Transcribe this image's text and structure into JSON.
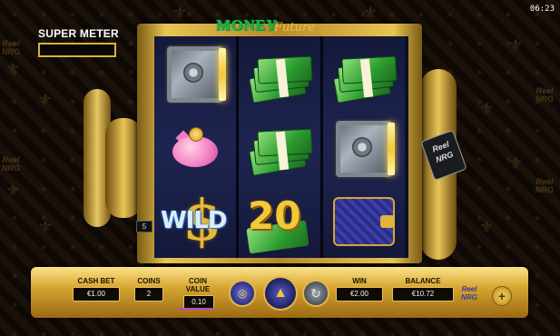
{
  "header": {
    "clock": "06:23"
  },
  "super_meter": {
    "label": "SUPER METER",
    "value": ""
  },
  "logo": {
    "money": "MONEY",
    "future": "Future"
  },
  "reels": [
    {
      "symbols": [
        "safe",
        "piggy-bank",
        "wild"
      ]
    },
    {
      "symbols": [
        "cash-stack",
        "cash-stack",
        "20"
      ]
    },
    {
      "symbols": [
        "cash-stack",
        "safe",
        "wallet"
      ]
    }
  ],
  "symbols_text": {
    "wild": "WILD",
    "dollar": "$",
    "twenty": "20"
  },
  "line_marker": "5",
  "tag": {
    "line1": "Reel",
    "line2": "NRG"
  },
  "brand_side": "Reel NRG",
  "controls": {
    "cash_bet_label": "CASH BET",
    "cash_bet_value": "€1.00",
    "coins_label": "COINS",
    "coins_value": "2",
    "coin_value_label": "COIN VALUE",
    "coin_value_value": "0.10",
    "win_label": "WIN",
    "win_value": "€2.00",
    "balance_label": "BALANCE",
    "balance_value": "€10.72",
    "brand": "Reel NRG",
    "spin_icon": "spin-arrow-icon",
    "autoplay_icon": "autoplay-icon",
    "plus_icon": "plus-icon"
  },
  "colors": {
    "gold": "#d9b23b",
    "purple": "#2e2f86",
    "panel": "#d8a531"
  }
}
